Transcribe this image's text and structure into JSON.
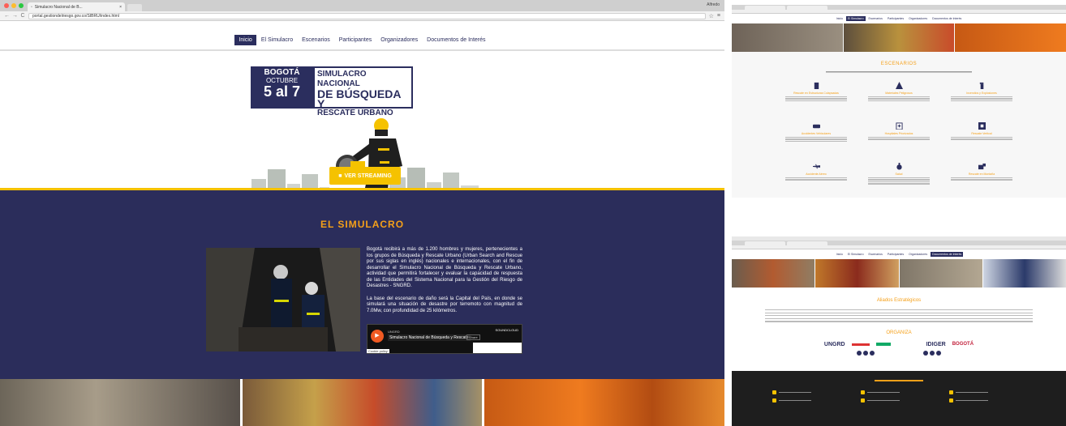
{
  "main": {
    "tab_title": "Simulacro Nacional de B...",
    "profile": "Alfredo",
    "url": "portal.gestiondelriesgo.gov.co/SIBRU/index.html",
    "nav": [
      "Inicio",
      "El Simulacro",
      "Escenarios",
      "Participantes",
      "Organizadores",
      "Documentos de Interés"
    ],
    "banner": {
      "city": "BOGOTÁ",
      "month": "OCTUBRE",
      "dates": "5 al 7",
      "line1": "SIMULACRO NACIONAL",
      "line2": "DE BÚSQUEDA Y",
      "line3": "RESCATE URBANO"
    },
    "stream_button": "VER STREAMING",
    "section_title": "EL SIMULACRO",
    "paragraph1": "Bogotá recibirá a más de 1.200 hombres y mujeres, pertenecientes a los grupos de Búsqueda y Rescate Urbano (Urban Search and Rescue por sus siglas en inglés) nacionales e internacionales, con el fin de desarrollar el Simulacro Nacional de Búsqueda y Rescate Urbano, actividad que permitirá fortalecer y evaluar la capacidad de respuesta de las Entidades del Sistema Nacional para la Gestión del Riesgo de Desastres - SNGRD.",
    "paragraph2": "La base del escenario de daño será la Capital del País, en donde se simulará una situación de desastre por terremoto con magnitud de 7.0Mw, con profundidad de 25 kilómetros.",
    "player": {
      "user": "UNGRD",
      "title": "Simulacro Nacional de Búsqueda y Rescate",
      "share": "Share",
      "brand": "SOUNDCLOUD",
      "cookie": "Cookie policy"
    }
  },
  "escenarios": {
    "title": "ESCENARIOS",
    "items": [
      {
        "name": "Rescate en Estructuras Colapsadas",
        "icon": "building-icon"
      },
      {
        "name": "Materiales Peligrosos",
        "icon": "warning-icon"
      },
      {
        "name": "Incendios y Explosiones",
        "icon": "extinguisher-icon"
      },
      {
        "name": "Accidentes Vehiculares",
        "icon": "car-icon"
      },
      {
        "name": "Hospitales Priorizados",
        "icon": "hospital-icon"
      },
      {
        "name": "Rescate Vertical",
        "icon": "rope-icon"
      },
      {
        "name": "Accidente Aéreo",
        "icon": "plane-icon"
      },
      {
        "name": "Salud",
        "icon": "medical-icon"
      },
      {
        "name": "Rescate en Montaña",
        "icon": "mountain-icon"
      }
    ]
  },
  "aliados": {
    "title": "Aliados Estratégicos",
    "organiza_title": "ORGANIZA",
    "logos": [
      "UNGRD",
      "IDIGER",
      "BOGOTÁ"
    ]
  },
  "colors": {
    "navy": "#2b2d5b",
    "accent": "#f5a019",
    "yellow": "#f5c200"
  }
}
